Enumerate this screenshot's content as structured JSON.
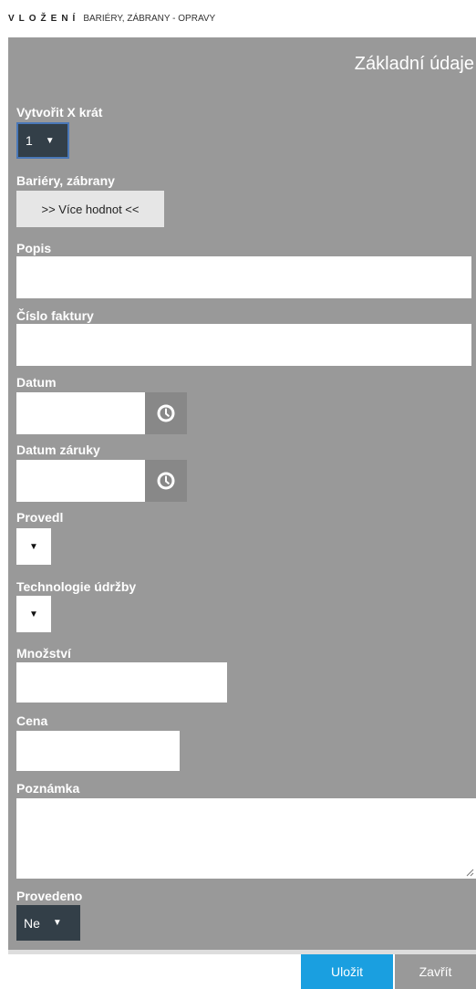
{
  "header": {
    "title": "VLOŽENÍ",
    "subtitle": "BARIÉRY, ZÁBRANY - OPRAVY"
  },
  "section_title": "Základní údaje",
  "fields": {
    "repeat": {
      "label": "Vytvořit X krát",
      "value": "1",
      "arrow": "▼"
    },
    "barriers": {
      "label": "Bariéry, zábrany",
      "button": ">> Více hodnot <<"
    },
    "description": {
      "label": "Popis",
      "value": ""
    },
    "invoice": {
      "label": "Číslo faktury",
      "value": ""
    },
    "date": {
      "label": "Datum",
      "value": "",
      "icon": "clock-icon"
    },
    "warranty": {
      "label": "Datum záruky",
      "value": "",
      "icon": "clock-icon"
    },
    "performed_by": {
      "label": "Provedl",
      "value": "",
      "arrow": "▼"
    },
    "technology": {
      "label": "Technologie údržby",
      "value": "",
      "arrow": "▼"
    },
    "quantity": {
      "label": "Množství",
      "value": ""
    },
    "price": {
      "label": "Cena",
      "value": ""
    },
    "note": {
      "label": "Poznámka",
      "value": ""
    },
    "done": {
      "label": "Provedeno",
      "value": "Ne",
      "arrow": "▼"
    }
  },
  "buttons": {
    "save": "Uložit",
    "close": "Zavřít"
  },
  "colors": {
    "panel": "#999999",
    "dark_select": "#333f48",
    "primary": "#1a9fe0",
    "focus": "#4a78b8"
  }
}
